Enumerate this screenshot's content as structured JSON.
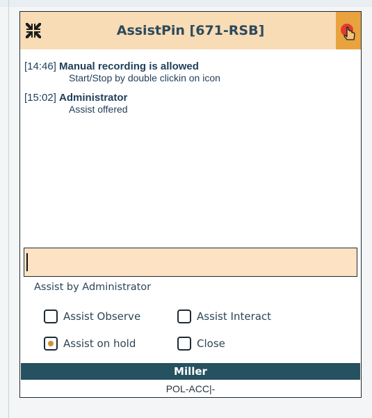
{
  "window": {
    "title": "AssistPin [671-RSB]",
    "compress_icon": "compress-icon",
    "pin_icon": "pin-hand-icon",
    "accent_color": "#e8a33e",
    "titlebar_color": "#f8dcb6"
  },
  "log": [
    {
      "time": "[14:46]",
      "title": "Manual recording is allowed",
      "detail": "Start/Stop by double clickin on icon"
    },
    {
      "time": "[15:02]",
      "title": "Administrator",
      "detail": "Assist offered"
    }
  ],
  "message_input": {
    "value": "",
    "placeholder": ""
  },
  "assist": {
    "heading": "Assist by Administrator",
    "options": [
      {
        "label": "Assist Observe",
        "checked": false
      },
      {
        "label": "Assist Interact",
        "checked": false
      },
      {
        "label": "Assist on hold",
        "checked": true
      },
      {
        "label": "Close",
        "checked": false
      }
    ]
  },
  "footer": {
    "name": "Miller",
    "code": "POL-ACC|-",
    "band_color": "#255160"
  }
}
